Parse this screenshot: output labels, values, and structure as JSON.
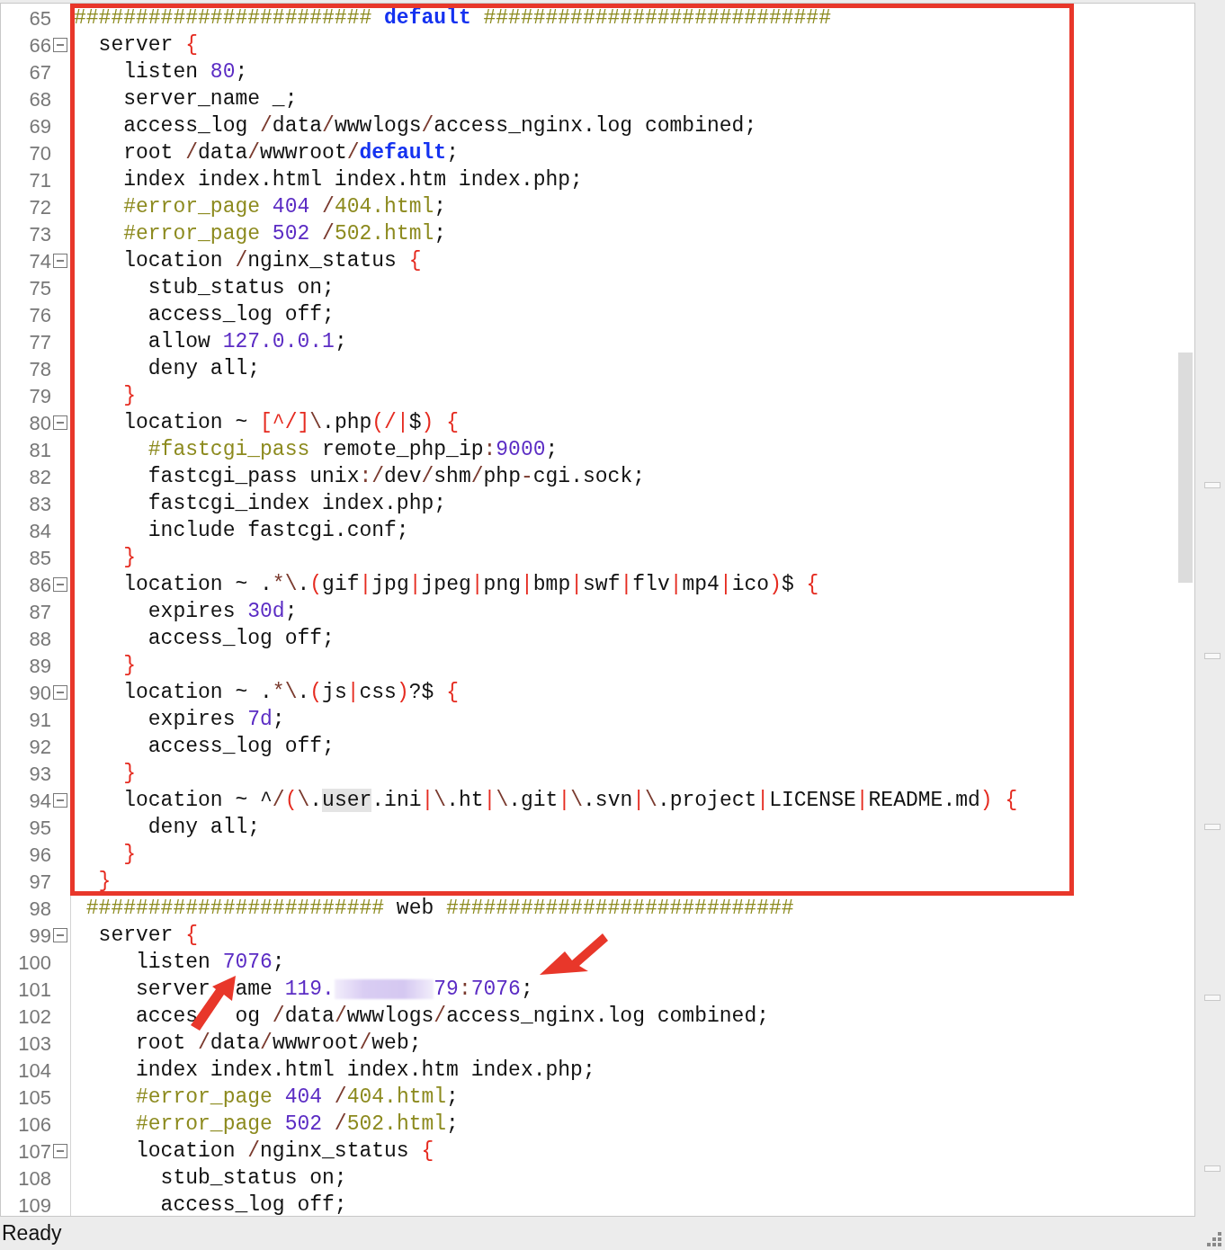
{
  "editor": {
    "lines": [
      {
        "number": "65",
        "tokens": [
          {
            "kind": "comment",
            "text": "########################"
          },
          {
            "kind": "keyword",
            "text": " default "
          },
          {
            "kind": "comment",
            "text": "############################"
          }
        ]
      },
      {
        "number": "66",
        "fold": true,
        "tokens": [
          {
            "kind": "plain",
            "text": "  server "
          },
          {
            "kind": "brace",
            "text": "{"
          }
        ]
      },
      {
        "number": "67",
        "tokens": [
          {
            "kind": "plain",
            "text": "    listen "
          },
          {
            "kind": "number",
            "text": "80"
          },
          {
            "kind": "plain",
            "text": ";"
          }
        ]
      },
      {
        "number": "68",
        "tokens": [
          {
            "kind": "plain",
            "text": "    server_name _;"
          }
        ]
      },
      {
        "number": "69",
        "tokens": [
          {
            "kind": "plain",
            "text": "    access_log "
          },
          {
            "kind": "slash",
            "text": "/"
          },
          {
            "kind": "plain",
            "text": "data"
          },
          {
            "kind": "slash",
            "text": "/"
          },
          {
            "kind": "plain",
            "text": "wwwlogs"
          },
          {
            "kind": "slash",
            "text": "/"
          },
          {
            "kind": "plain",
            "text": "access_nginx.log combined;"
          }
        ]
      },
      {
        "number": "70",
        "tokens": [
          {
            "kind": "plain",
            "text": "    root "
          },
          {
            "kind": "slash",
            "text": "/"
          },
          {
            "kind": "plain",
            "text": "data"
          },
          {
            "kind": "slash",
            "text": "/"
          },
          {
            "kind": "plain",
            "text": "wwwroot"
          },
          {
            "kind": "slash",
            "text": "/"
          },
          {
            "kind": "keyword",
            "text": "default"
          },
          {
            "kind": "plain",
            "text": ";"
          }
        ]
      },
      {
        "number": "71",
        "tokens": [
          {
            "kind": "plain",
            "text": "    index index.html index.htm index.php;"
          }
        ]
      },
      {
        "number": "72",
        "tokens": [
          {
            "kind": "comment",
            "text": "    #error_page "
          },
          {
            "kind": "number",
            "text": "404"
          },
          {
            "kind": "slash",
            "text": " /"
          },
          {
            "kind": "comment",
            "text": "404.html"
          },
          {
            "kind": "plain",
            "text": ";"
          }
        ]
      },
      {
        "number": "73",
        "tokens": [
          {
            "kind": "comment",
            "text": "    #error_page "
          },
          {
            "kind": "number",
            "text": "502"
          },
          {
            "kind": "slash",
            "text": " /"
          },
          {
            "kind": "comment",
            "text": "502.html"
          },
          {
            "kind": "plain",
            "text": ";"
          }
        ]
      },
      {
        "number": "74",
        "fold": true,
        "tokens": [
          {
            "kind": "plain",
            "text": "    location "
          },
          {
            "kind": "slash",
            "text": "/"
          },
          {
            "kind": "plain",
            "text": "nginx_status "
          },
          {
            "kind": "brace",
            "text": "{"
          }
        ]
      },
      {
        "number": "75",
        "tokens": [
          {
            "kind": "plain",
            "text": "      stub_status on;"
          }
        ]
      },
      {
        "number": "76",
        "tokens": [
          {
            "kind": "plain",
            "text": "      access_log off;"
          }
        ]
      },
      {
        "number": "77",
        "tokens": [
          {
            "kind": "plain",
            "text": "      allow "
          },
          {
            "kind": "number",
            "text": "127.0.0.1"
          },
          {
            "kind": "plain",
            "text": ";"
          }
        ]
      },
      {
        "number": "78",
        "tokens": [
          {
            "kind": "plain",
            "text": "      deny all;"
          }
        ]
      },
      {
        "number": "79",
        "tokens": [
          {
            "kind": "brace",
            "text": "    }"
          }
        ]
      },
      {
        "number": "80",
        "fold": true,
        "tokens": [
          {
            "kind": "plain",
            "text": "    location ~ "
          },
          {
            "kind": "regex",
            "text": "[^/]"
          },
          {
            "kind": "slash",
            "text": "\\"
          },
          {
            "kind": "plain",
            "text": ".php"
          },
          {
            "kind": "regex",
            "text": "(/|"
          },
          {
            "kind": "plain",
            "text": "$"
          },
          {
            "kind": "regex",
            "text": ")"
          },
          {
            "kind": "brace",
            "text": " {"
          }
        ]
      },
      {
        "number": "81",
        "tokens": [
          {
            "kind": "comment",
            "text": "      #fastcgi_pass"
          },
          {
            "kind": "plain",
            "text": " remote_php_ip"
          },
          {
            "kind": "slash",
            "text": ":"
          },
          {
            "kind": "number",
            "text": "9000"
          },
          {
            "kind": "plain",
            "text": ";"
          }
        ]
      },
      {
        "number": "82",
        "tokens": [
          {
            "kind": "plain",
            "text": "      fastcgi_pass unix"
          },
          {
            "kind": "slash",
            "text": ":/"
          },
          {
            "kind": "plain",
            "text": "dev"
          },
          {
            "kind": "slash",
            "text": "/"
          },
          {
            "kind": "plain",
            "text": "shm"
          },
          {
            "kind": "slash",
            "text": "/"
          },
          {
            "kind": "plain",
            "text": "php"
          },
          {
            "kind": "slash",
            "text": "-"
          },
          {
            "kind": "plain",
            "text": "cgi.sock;"
          }
        ]
      },
      {
        "number": "83",
        "tokens": [
          {
            "kind": "plain",
            "text": "      fastcgi_index index.php;"
          }
        ]
      },
      {
        "number": "84",
        "tokens": [
          {
            "kind": "plain",
            "text": "      include fastcgi.conf;"
          }
        ]
      },
      {
        "number": "85",
        "tokens": [
          {
            "kind": "brace",
            "text": "    }"
          }
        ]
      },
      {
        "number": "86",
        "fold": true,
        "tokens": [
          {
            "kind": "plain",
            "text": "    location ~ ."
          },
          {
            "kind": "slash",
            "text": "*\\"
          },
          {
            "kind": "plain",
            "text": "."
          },
          {
            "kind": "regex",
            "text": "("
          },
          {
            "kind": "plain",
            "text": "gif"
          },
          {
            "kind": "regex",
            "text": "|"
          },
          {
            "kind": "plain",
            "text": "jpg"
          },
          {
            "kind": "regex",
            "text": "|"
          },
          {
            "kind": "plain",
            "text": "jpeg"
          },
          {
            "kind": "regex",
            "text": "|"
          },
          {
            "kind": "plain",
            "text": "png"
          },
          {
            "kind": "regex",
            "text": "|"
          },
          {
            "kind": "plain",
            "text": "bmp"
          },
          {
            "kind": "regex",
            "text": "|"
          },
          {
            "kind": "plain",
            "text": "swf"
          },
          {
            "kind": "regex",
            "text": "|"
          },
          {
            "kind": "plain",
            "text": "flv"
          },
          {
            "kind": "regex",
            "text": "|"
          },
          {
            "kind": "plain",
            "text": "mp4"
          },
          {
            "kind": "regex",
            "text": "|"
          },
          {
            "kind": "plain",
            "text": "ico"
          },
          {
            "kind": "regex",
            "text": ")"
          },
          {
            "kind": "plain",
            "text": "$ "
          },
          {
            "kind": "brace",
            "text": "{"
          }
        ]
      },
      {
        "number": "87",
        "tokens": [
          {
            "kind": "plain",
            "text": "      expires "
          },
          {
            "kind": "number",
            "text": "30d"
          },
          {
            "kind": "plain",
            "text": ";"
          }
        ]
      },
      {
        "number": "88",
        "tokens": [
          {
            "kind": "plain",
            "text": "      access_log off;"
          }
        ]
      },
      {
        "number": "89",
        "tokens": [
          {
            "kind": "brace",
            "text": "    }"
          }
        ]
      },
      {
        "number": "90",
        "fold": true,
        "tokens": [
          {
            "kind": "plain",
            "text": "    location ~ ."
          },
          {
            "kind": "slash",
            "text": "*\\"
          },
          {
            "kind": "plain",
            "text": "."
          },
          {
            "kind": "regex",
            "text": "("
          },
          {
            "kind": "plain",
            "text": "js"
          },
          {
            "kind": "regex",
            "text": "|"
          },
          {
            "kind": "plain",
            "text": "css"
          },
          {
            "kind": "regex",
            "text": ")"
          },
          {
            "kind": "plain",
            "text": "?$ "
          },
          {
            "kind": "brace",
            "text": "{"
          }
        ]
      },
      {
        "number": "91",
        "tokens": [
          {
            "kind": "plain",
            "text": "      expires "
          },
          {
            "kind": "number",
            "text": "7d"
          },
          {
            "kind": "plain",
            "text": ";"
          }
        ]
      },
      {
        "number": "92",
        "tokens": [
          {
            "kind": "plain",
            "text": "      access_log off;"
          }
        ]
      },
      {
        "number": "93",
        "tokens": [
          {
            "kind": "brace",
            "text": "    }"
          }
        ]
      },
      {
        "number": "94",
        "fold": true,
        "tokens": [
          {
            "kind": "plain",
            "text": "    location ~ ^"
          },
          {
            "kind": "slash",
            "text": "/"
          },
          {
            "kind": "regex",
            "text": "("
          },
          {
            "kind": "slash",
            "text": "\\"
          },
          {
            "kind": "plain",
            "text": "."
          },
          {
            "kind": "highlight",
            "text": "user"
          },
          {
            "kind": "plain",
            "text": ".ini"
          },
          {
            "kind": "regex",
            "text": "|"
          },
          {
            "kind": "slash",
            "text": "\\"
          },
          {
            "kind": "plain",
            "text": ".ht"
          },
          {
            "kind": "regex",
            "text": "|"
          },
          {
            "kind": "slash",
            "text": "\\"
          },
          {
            "kind": "plain",
            "text": ".git"
          },
          {
            "kind": "regex",
            "text": "|"
          },
          {
            "kind": "slash",
            "text": "\\"
          },
          {
            "kind": "plain",
            "text": ".svn"
          },
          {
            "kind": "regex",
            "text": "|"
          },
          {
            "kind": "slash",
            "text": "\\"
          },
          {
            "kind": "plain",
            "text": ".project"
          },
          {
            "kind": "regex",
            "text": "|"
          },
          {
            "kind": "plain",
            "text": "LICENSE"
          },
          {
            "kind": "regex",
            "text": "|"
          },
          {
            "kind": "plain",
            "text": "README.md"
          },
          {
            "kind": "regex",
            "text": ")"
          },
          {
            "kind": "brace",
            "text": " {"
          }
        ]
      },
      {
        "number": "95",
        "tokens": [
          {
            "kind": "plain",
            "text": "      deny all;"
          }
        ]
      },
      {
        "number": "96",
        "tokens": [
          {
            "kind": "brace",
            "text": "    }"
          }
        ]
      },
      {
        "number": "97",
        "tokens": [
          {
            "kind": "brace",
            "text": "  }"
          }
        ]
      },
      {
        "number": "98",
        "tokens": [
          {
            "kind": "comment",
            "text": " ########################"
          },
          {
            "kind": "plain",
            "text": " web "
          },
          {
            "kind": "comment",
            "text": "############################"
          }
        ]
      },
      {
        "number": "99",
        "fold": true,
        "tokens": [
          {
            "kind": "plain",
            "text": "  server "
          },
          {
            "kind": "brace",
            "text": "{"
          }
        ]
      },
      {
        "number": "100",
        "tokens": [
          {
            "kind": "plain",
            "text": "     listen "
          },
          {
            "kind": "number",
            "text": "7076"
          },
          {
            "kind": "plain",
            "text": ";"
          }
        ]
      },
      {
        "number": "101",
        "tokens": [
          {
            "kind": "plain",
            "text": "     server"
          },
          {
            "kind": "gap"
          },
          {
            "kind": "gap"
          },
          {
            "kind": "plain",
            "text": "ame "
          },
          {
            "kind": "number",
            "text": "119."
          },
          {
            "kind": "redacted"
          },
          {
            "kind": "number",
            "text": "79"
          },
          {
            "kind": "slash",
            "text": ":"
          },
          {
            "kind": "number",
            "text": "7076"
          },
          {
            "kind": "plain",
            "text": ";"
          }
        ]
      },
      {
        "number": "102",
        "tokens": [
          {
            "kind": "plain",
            "text": "     acces"
          },
          {
            "kind": "gap"
          },
          {
            "kind": "gap"
          },
          {
            "kind": "gap"
          },
          {
            "kind": "plain",
            "text": "og "
          },
          {
            "kind": "slash",
            "text": "/"
          },
          {
            "kind": "plain",
            "text": "data"
          },
          {
            "kind": "slash",
            "text": "/"
          },
          {
            "kind": "plain",
            "text": "wwwlogs"
          },
          {
            "kind": "slash",
            "text": "/"
          },
          {
            "kind": "plain",
            "text": "access_nginx.log combined;"
          }
        ]
      },
      {
        "number": "103",
        "tokens": [
          {
            "kind": "plain",
            "text": "     root "
          },
          {
            "kind": "slash",
            "text": "/"
          },
          {
            "kind": "plain",
            "text": "data"
          },
          {
            "kind": "slash",
            "text": "/"
          },
          {
            "kind": "plain",
            "text": "wwwroot"
          },
          {
            "kind": "slash",
            "text": "/"
          },
          {
            "kind": "plain",
            "text": "web;"
          }
        ]
      },
      {
        "number": "104",
        "tokens": [
          {
            "kind": "plain",
            "text": "     index index.html index.htm index.php;"
          }
        ]
      },
      {
        "number": "105",
        "tokens": [
          {
            "kind": "comment",
            "text": "     #error_page "
          },
          {
            "kind": "number",
            "text": "404"
          },
          {
            "kind": "slash",
            "text": " /"
          },
          {
            "kind": "comment",
            "text": "404.html"
          },
          {
            "kind": "plain",
            "text": ";"
          }
        ]
      },
      {
        "number": "106",
        "tokens": [
          {
            "kind": "comment",
            "text": "     #error_page "
          },
          {
            "kind": "number",
            "text": "502"
          },
          {
            "kind": "slash",
            "text": " /"
          },
          {
            "kind": "comment",
            "text": "502.html"
          },
          {
            "kind": "plain",
            "text": ";"
          }
        ]
      },
      {
        "number": "107",
        "fold": true,
        "tokens": [
          {
            "kind": "plain",
            "text": "     location "
          },
          {
            "kind": "slash",
            "text": "/"
          },
          {
            "kind": "plain",
            "text": "nginx_status "
          },
          {
            "kind": "brace",
            "text": "{"
          }
        ]
      },
      {
        "number": "108",
        "tokens": [
          {
            "kind": "plain",
            "text": "       stub_status on;"
          }
        ]
      },
      {
        "number": "109",
        "tokens": [
          {
            "kind": "plain",
            "text": "       access_log off;"
          }
        ]
      }
    ]
  },
  "annotations": [
    {
      "kind": "frame"
    },
    {
      "kind": "arrow"
    },
    {
      "kind": "arrow"
    }
  ],
  "status_bar": {
    "text": "Ready"
  }
}
